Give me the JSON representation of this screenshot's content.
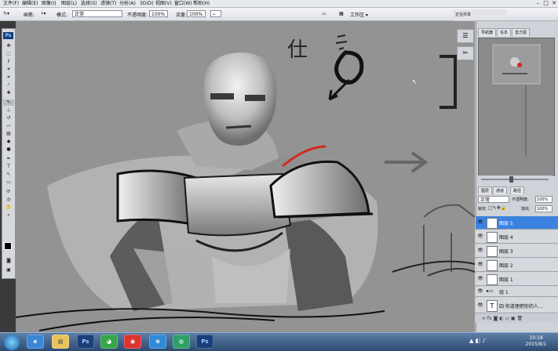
{
  "menu": {
    "items": [
      "文件(F)",
      "编辑(E)",
      "图像(I)",
      "图层(L)",
      "选择(S)",
      "滤镜(T)",
      "分析(A)",
      "3D(D)",
      "视图(V)",
      "窗口(W)",
      "帮助(H)"
    ],
    "window_buttons": [
      "–",
      "□",
      "✕"
    ]
  },
  "options": {
    "brush_label": "画笔:",
    "mode_label": "模式:",
    "mode_value": "正常",
    "opacity_label": "不透明度:",
    "opacity_value": "100%",
    "flow_label": "流量:",
    "flow_value": "100%",
    "workspace_label": "工作区 ▾"
  },
  "mini_dock": {
    "title": "正在共享"
  },
  "panels": {
    "top_tabs": [
      "导航器",
      "信息",
      "直方图"
    ],
    "zoom_value": "",
    "layer_tabs": [
      "图层",
      "通道",
      "路径"
    ],
    "blend_mode": "正常",
    "opacity_label": "不透明度:",
    "opacity_value": "100%",
    "lock_label": "锁定:",
    "fill_label": "填充:",
    "fill_value": "100%",
    "layers": [
      {
        "name": "图层 5",
        "active": true
      },
      {
        "name": "图层 4",
        "active": false
      },
      {
        "name": "图层 3",
        "active": false
      },
      {
        "name": "图层 2",
        "active": false
      },
      {
        "name": "图层 1",
        "active": false
      },
      {
        "name": "组 1",
        "active": false
      },
      {
        "name": "四·你道理把你的人…",
        "active": false
      }
    ]
  },
  "taskbar": {
    "apps": [
      "start",
      "explorer",
      "library",
      "ps",
      "qq",
      "browser",
      "chrome",
      "ie",
      "ps2"
    ],
    "time": "10:18",
    "date": "2015/8/1"
  },
  "colors": {
    "accent": "#3b82e0",
    "canvas": "#939393"
  }
}
